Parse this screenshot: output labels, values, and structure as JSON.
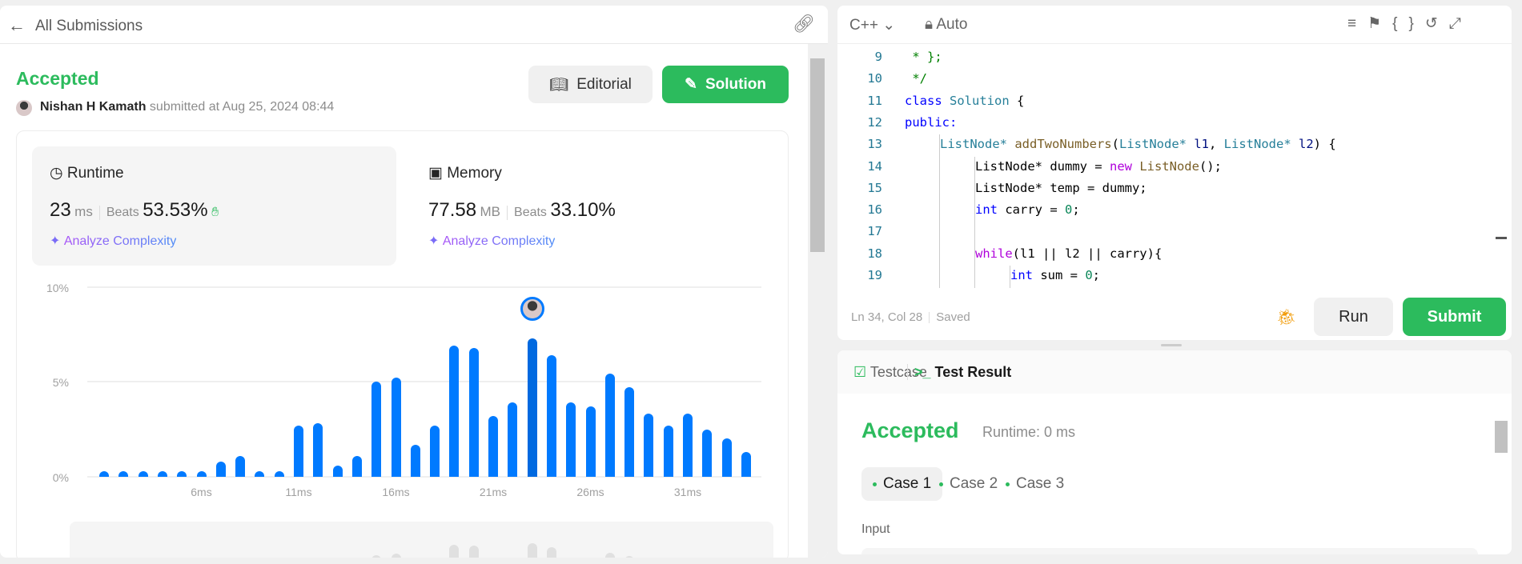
{
  "header": {
    "back_label": "All Submissions",
    "back_icon": "arrow-left-icon",
    "share_icon": "link-icon"
  },
  "submission": {
    "status": "Accepted",
    "status_color": "#2cbb5d",
    "user": "Nishan H Kamath",
    "submitted_text": "submitted at Aug 25, 2024 08:44",
    "editorial_label": "Editorial",
    "solution_label": "Solution"
  },
  "runtime": {
    "label": "Runtime",
    "value": "23",
    "unit": "ms",
    "beats_label": "Beats",
    "beats": "53.53%",
    "analyze": "Analyze Complexity"
  },
  "memory": {
    "label": "Memory",
    "value": "77.58",
    "unit": "MB",
    "beats_label": "Beats",
    "beats": "33.10%",
    "analyze": "Analyze Complexity"
  },
  "chart_data": {
    "type": "bar",
    "x": [
      1,
      2,
      3,
      4,
      5,
      6,
      7,
      8,
      9,
      10,
      11,
      12,
      13,
      14,
      15,
      16,
      17,
      18,
      19,
      20,
      21,
      22,
      23,
      24,
      25,
      26,
      27,
      28,
      29,
      30,
      31,
      32,
      33,
      34
    ],
    "values": [
      0.3,
      0.3,
      0.3,
      0.3,
      0.3,
      0.3,
      0.8,
      1.1,
      0.3,
      0.3,
      2.7,
      2.8,
      0.6,
      1.1,
      5.0,
      5.2,
      1.7,
      2.7,
      6.9,
      6.75,
      3.2,
      3.9,
      7.25,
      6.4,
      3.9,
      3.7,
      5.4,
      4.7,
      3.3,
      2.7,
      3.3,
      2.5,
      2.0,
      1.3
    ],
    "x_unit": "ms",
    "highlight_x": 23,
    "ylim": [
      0,
      10
    ],
    "yticks": [
      "0%",
      "5%",
      "10%"
    ],
    "xticks": [
      "6ms",
      "11ms",
      "16ms",
      "21ms",
      "26ms",
      "31ms"
    ],
    "grid": true,
    "bar_color": "#007aff",
    "highlight_color": "#0069e0"
  },
  "editor": {
    "language": "C++",
    "mode": "Auto",
    "lines": [
      {
        "n": "9",
        "indent": 0,
        "tokens": [
          [
            " * };",
            "cm"
          ]
        ]
      },
      {
        "n": "10",
        "indent": 0,
        "tokens": [
          [
            " */",
            "cm"
          ]
        ]
      },
      {
        "n": "11",
        "indent": 0,
        "tokens": [
          [
            "class ",
            "kw"
          ],
          [
            "Solution",
            "ty"
          ],
          [
            " {",
            "tx"
          ]
        ]
      },
      {
        "n": "12",
        "indent": 0,
        "tokens": [
          [
            "public:",
            "kw"
          ]
        ]
      },
      {
        "n": "13",
        "indent": 1,
        "tokens": [
          [
            "ListNode",
            "ty"
          ],
          [
            "* ",
            "ty"
          ],
          [
            "addTwoNumbers",
            "fn"
          ],
          [
            "(",
            "tx"
          ],
          [
            "ListNode",
            "ty"
          ],
          [
            "* ",
            "ty"
          ],
          [
            "l1",
            "vr"
          ],
          [
            ", ",
            "tx"
          ],
          [
            "ListNode",
            "ty"
          ],
          [
            "* ",
            "ty"
          ],
          [
            "l2",
            "vr"
          ],
          [
            ") {",
            "tx"
          ]
        ]
      },
      {
        "n": "14",
        "indent": 2,
        "tokens": [
          [
            "ListNode* dummy = ",
            "tx"
          ],
          [
            "new ",
            "ctl"
          ],
          [
            "ListNode",
            "fn"
          ],
          [
            "();",
            "tx"
          ]
        ]
      },
      {
        "n": "15",
        "indent": 2,
        "tokens": [
          [
            "ListNode* temp = dummy;",
            "tx"
          ]
        ]
      },
      {
        "n": "16",
        "indent": 2,
        "tokens": [
          [
            "int ",
            "kw"
          ],
          [
            "carry = ",
            "tx"
          ],
          [
            "0",
            "nm"
          ],
          [
            ";",
            "tx"
          ]
        ]
      },
      {
        "n": "17",
        "indent": 2,
        "tokens": []
      },
      {
        "n": "18",
        "indent": 2,
        "tokens": [
          [
            "while",
            "ctl"
          ],
          [
            "(l1 || l2 || carry){",
            "tx"
          ]
        ]
      },
      {
        "n": "19",
        "indent": 3,
        "tokens": [
          [
            "int ",
            "kw"
          ],
          [
            "sum = ",
            "tx"
          ],
          [
            "0",
            "nm"
          ],
          [
            ";",
            "tx"
          ]
        ]
      }
    ],
    "cursor": "Ln 34, Col 28",
    "save_state": "Saved",
    "run_label": "Run",
    "submit_label": "Submit"
  },
  "result": {
    "tab_testcase": "Testcase",
    "tab_result": "Test Result",
    "status": "Accepted",
    "runtime": "Runtime: 0 ms",
    "cases": [
      "Case 1",
      "Case 2",
      "Case 3"
    ],
    "input_label": "Input"
  }
}
